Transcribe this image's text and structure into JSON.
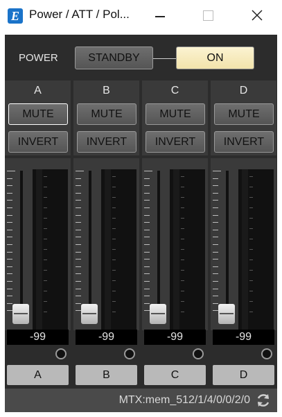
{
  "window": {
    "title": "Power / ATT / Pol...",
    "app_icon_letter": "E"
  },
  "power": {
    "label": "POWER",
    "standby_label": "STANDBY",
    "on_label": "ON",
    "state": "ON"
  },
  "channels": [
    {
      "name": "A",
      "mute": "MUTE",
      "invert": "INVERT",
      "value": "-99",
      "button": "A"
    },
    {
      "name": "B",
      "mute": "MUTE",
      "invert": "INVERT",
      "value": "-99",
      "button": "B"
    },
    {
      "name": "C",
      "mute": "MUTE",
      "invert": "INVERT",
      "value": "-99",
      "button": "C"
    },
    {
      "name": "D",
      "mute": "MUTE",
      "invert": "INVERT",
      "value": "-99",
      "button": "D"
    }
  ],
  "status": {
    "text": "MTX:mem_512/1/4/0/0/2/0"
  },
  "colors": {
    "on_active": "#f2e3ab",
    "panel": "#2c2c2c",
    "app_icon": "#1a73c9"
  }
}
